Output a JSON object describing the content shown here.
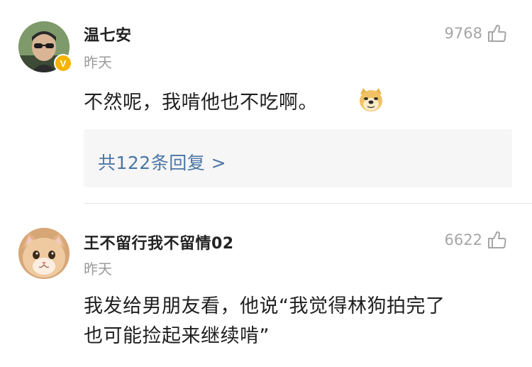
{
  "comments": [
    {
      "username": "温七安",
      "time": "昨天",
      "likes": "9768",
      "text": "不然呢，我啃他也不吃啊。",
      "emoji_icon": "doge-icon",
      "verified_badge": "V",
      "replies_label": "共122条回复 >"
    },
    {
      "username": "王不留行我不留情02",
      "time": "昨天",
      "likes": "6622",
      "text_line1": "我发给男朋友看，他说“我觉得林狗拍完了",
      "text_line2": "也可能捡起来继续啃”"
    }
  ],
  "colors": {
    "link": "#4b76a6",
    "verified": "#f5b400",
    "muted": "#9b9b9b",
    "reply_bg": "#f6f6f6"
  },
  "icons": [
    "thumbs-up-icon",
    "verified-badge-icon",
    "doge-icon"
  ]
}
